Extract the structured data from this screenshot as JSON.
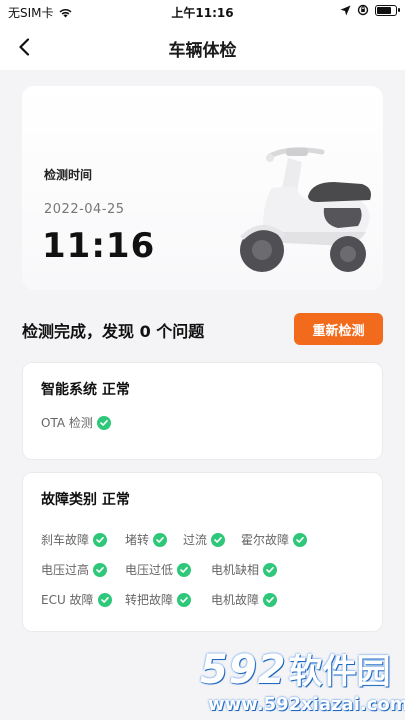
{
  "status_bar": {
    "carrier": "无SIM卡",
    "time": "上午11:16",
    "battery_level": 0.8
  },
  "nav": {
    "title": "车辆体检"
  },
  "hero": {
    "label": "检测时间",
    "date": "2022-04-25",
    "time": "11:16"
  },
  "summary": {
    "text": "检测完成，发现 0 个问题",
    "recheck_label": "重新检测"
  },
  "smart_system": {
    "title": "智能系统 正常",
    "items": [
      "OTA 检测"
    ]
  },
  "fault_category": {
    "title": "故障类别 正常",
    "items": [
      "刹车故障",
      "堵转",
      "过流",
      "霍尔故障",
      "电压过高",
      "电压过低",
      "电机缺相",
      "ECU 故障",
      "转把故障",
      "电机故障"
    ]
  },
  "watermark": {
    "num": "592",
    "cn": "软件园",
    "url": "www.592xiazai.com"
  },
  "colors": {
    "accent": "#f26b1d",
    "ok": "#2fc87a",
    "watermark": "#2a7de1"
  }
}
